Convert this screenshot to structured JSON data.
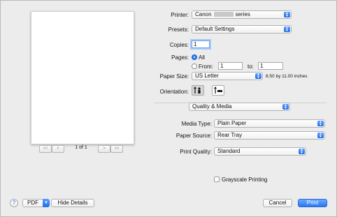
{
  "preview": {
    "page_count": "1 of 1",
    "nav": {
      "first": "<<",
      "prev": "<",
      "next": ">",
      "last": ">>"
    }
  },
  "printer": {
    "label": "Printer:",
    "value_prefix": "Canon",
    "value_suffix": "series"
  },
  "presets": {
    "label": "Presets:",
    "value": "Default Settings"
  },
  "copies": {
    "label": "Copies:",
    "value": "1"
  },
  "pages": {
    "label": "Pages:",
    "all": "All",
    "from_label": "From:",
    "from_value": "1",
    "to_label": "to:",
    "to_value": "1"
  },
  "paper_size": {
    "label": "Paper Size:",
    "value": "US Letter",
    "dimensions": "8.50 by 11.00 inches"
  },
  "orientation": {
    "label": "Orientation:"
  },
  "section": {
    "value": "Quality & Media"
  },
  "media_type": {
    "label": "Media Type:",
    "value": "Plain Paper"
  },
  "paper_source": {
    "label": "Paper Source:",
    "value": "Rear Tray"
  },
  "print_quality": {
    "label": "Print Quality:",
    "value": "Standard"
  },
  "grayscale": {
    "label": "Grayscale Printing"
  },
  "bottom": {
    "help": "?",
    "pdf": "PDF",
    "hide_details": "Hide Details",
    "cancel": "Cancel",
    "print": "Print"
  },
  "icons": {
    "stepper": "updown-chevron-icon",
    "pdf_menu": "chevron-down-icon",
    "portrait": "portrait-icon",
    "landscape": "landscape-icon"
  },
  "colors": {
    "accent": "#2a78ec",
    "background": "#ececec"
  }
}
